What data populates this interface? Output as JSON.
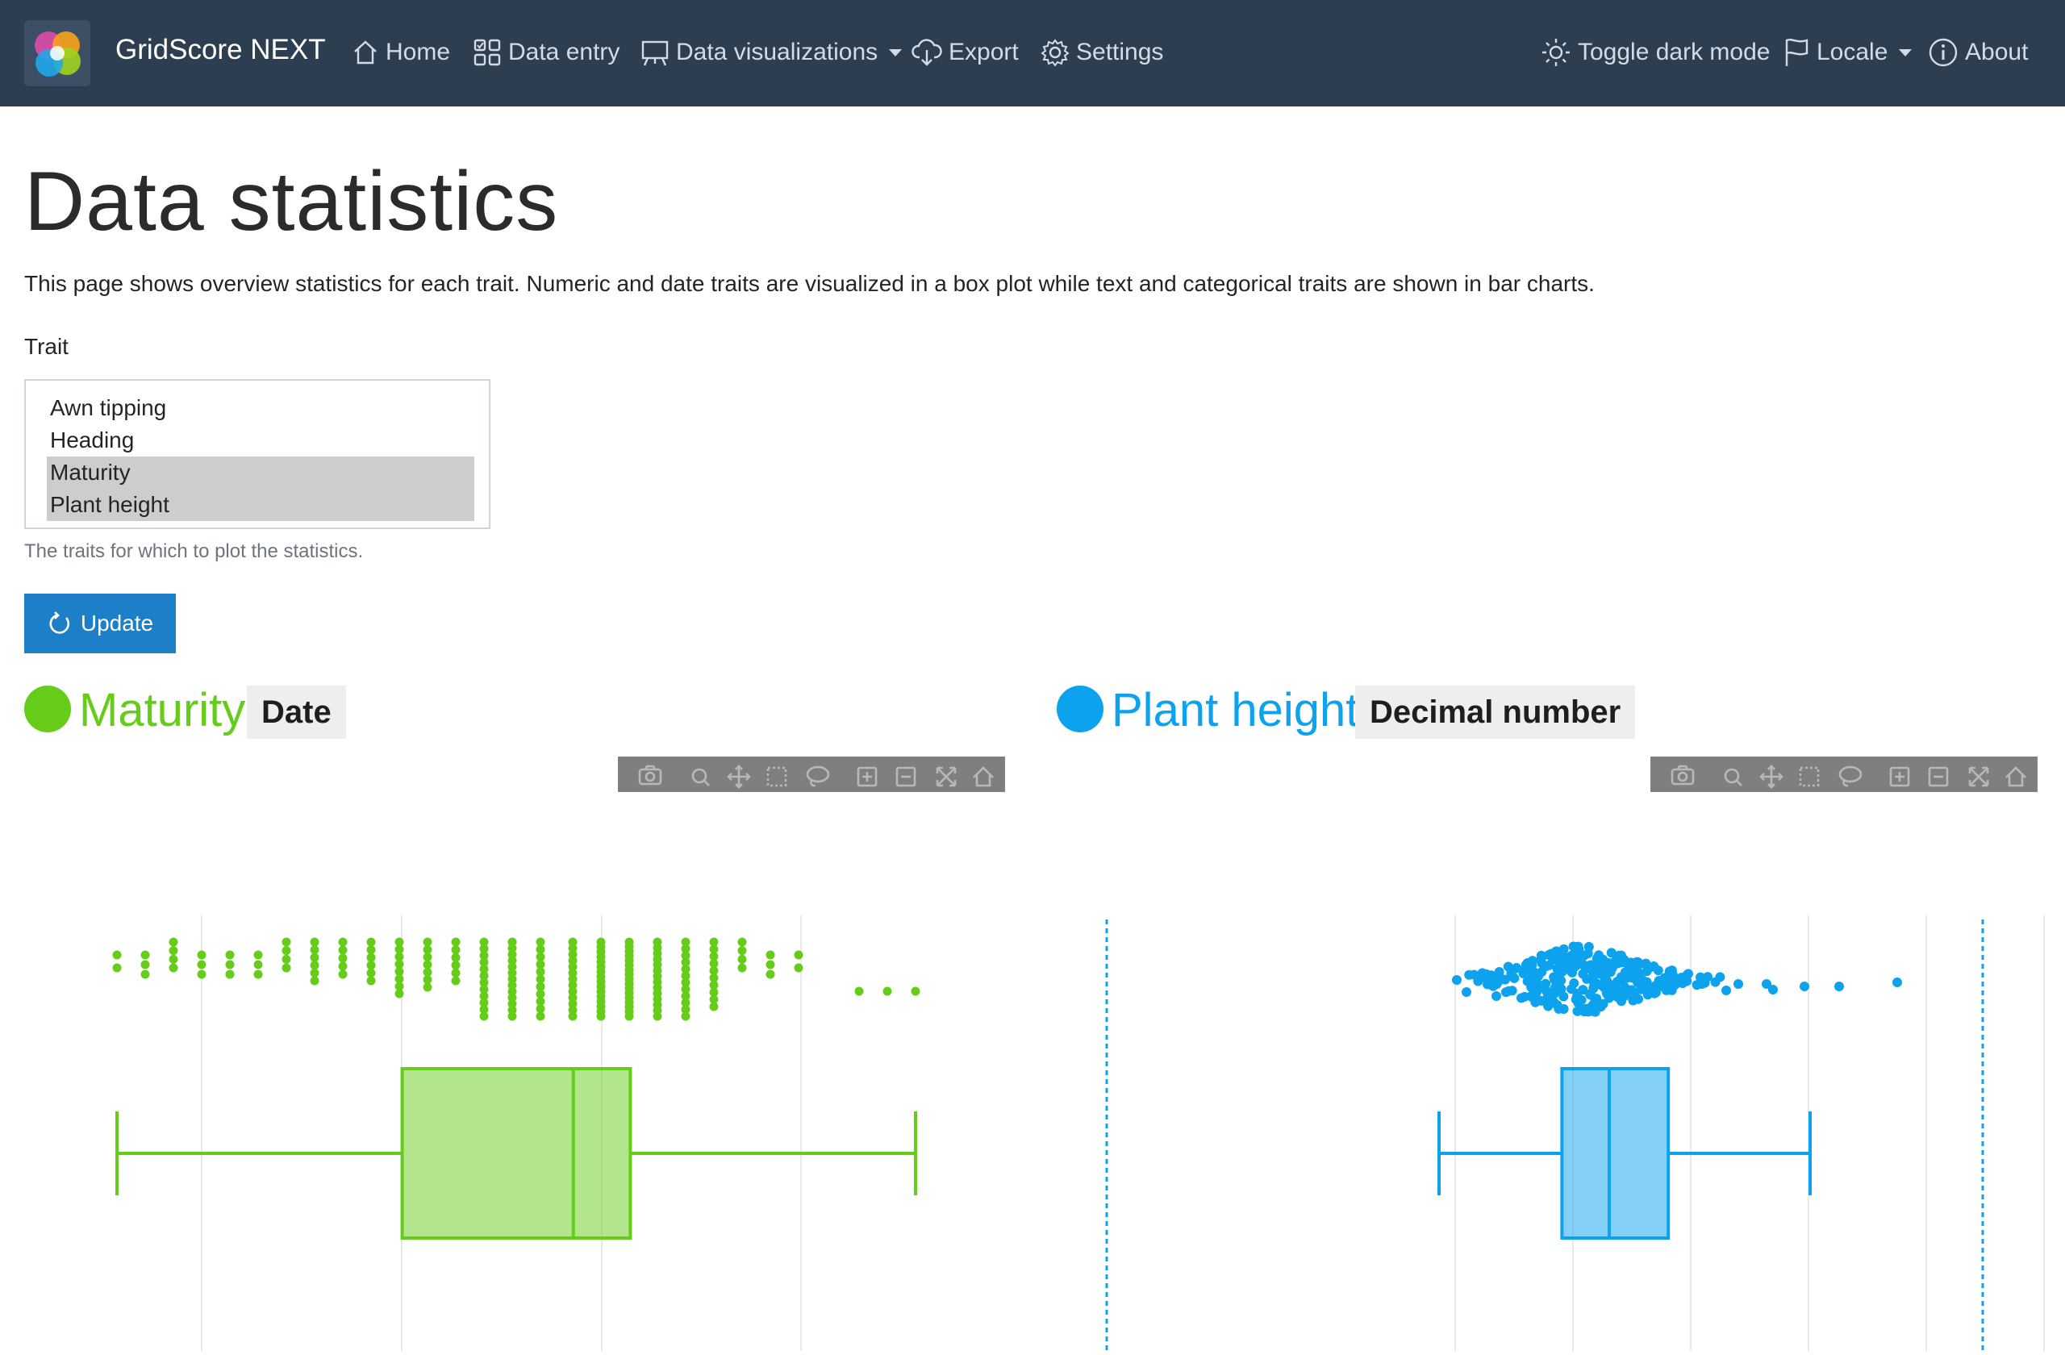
{
  "navbar": {
    "brand": "GridScore NEXT",
    "items": [
      {
        "label": "Home",
        "icon": "house-icon"
      },
      {
        "label": "Data entry",
        "icon": "grid-check-icon"
      },
      {
        "label": "Data visualizations",
        "icon": "easel-icon",
        "dropdown": true
      },
      {
        "label": "Export",
        "icon": "cloud-download-icon"
      },
      {
        "label": "Settings",
        "icon": "gear-icon"
      }
    ],
    "right_items": [
      {
        "label": "Toggle dark mode",
        "icon": "sun-icon"
      },
      {
        "label": "Locale",
        "icon": "flag-icon",
        "dropdown": true
      },
      {
        "label": "About",
        "icon": "info-circle-icon"
      }
    ]
  },
  "page": {
    "title": "Data statistics",
    "intro": "This page shows overview statistics for each trait. Numeric and date traits are visualized in a box plot while text and categorical traits are shown in bar charts."
  },
  "trait_select": {
    "label": "Trait",
    "options": [
      {
        "label": "Awn tipping",
        "selected": false
      },
      {
        "label": "Heading",
        "selected": false
      },
      {
        "label": "Maturity",
        "selected": true
      },
      {
        "label": "Plant height",
        "selected": true
      }
    ],
    "help": "The traits for which to plot the statistics.",
    "update_label": "Update"
  },
  "colors": {
    "navbar": "#2e3e51",
    "maturity": "#66cc1a",
    "plant_height": "#0ca2ee",
    "button": "#1e7fc9"
  },
  "traits": [
    {
      "name": "Maturity",
      "type": "Date",
      "color": "#66cc1a"
    },
    {
      "name": "Plant height",
      "type": "Decimal number",
      "color": "#0ca2ee"
    }
  ],
  "modebar_icons": [
    "camera-icon",
    "zoom-icon",
    "pan-icon",
    "box-select-icon",
    "lasso-select-icon",
    "zoom-in-icon",
    "zoom-out-icon",
    "autoscale-icon",
    "reset-axes-icon"
  ],
  "chart_data": [
    {
      "type": "box",
      "series": [
        {
          "name": "Maturity",
          "color": "#66cc1a"
        }
      ],
      "orientation": "horizontal",
      "points": "all",
      "box": {
        "min": 0,
        "q1": 10,
        "median": 16,
        "q3": 18,
        "max": 28
      },
      "ylabel": "",
      "xlabel": "",
      "grid": true
    },
    {
      "type": "box",
      "series": [
        {
          "name": "Plant height",
          "color": "#0ca2ee"
        }
      ],
      "orientation": "horizontal",
      "points": "all",
      "box": {
        "min": 0,
        "q1": 5.2,
        "median": 7.2,
        "q3": 9.7,
        "max": 15.7
      },
      "ylabel": "",
      "xlabel": "",
      "grid": true
    }
  ]
}
